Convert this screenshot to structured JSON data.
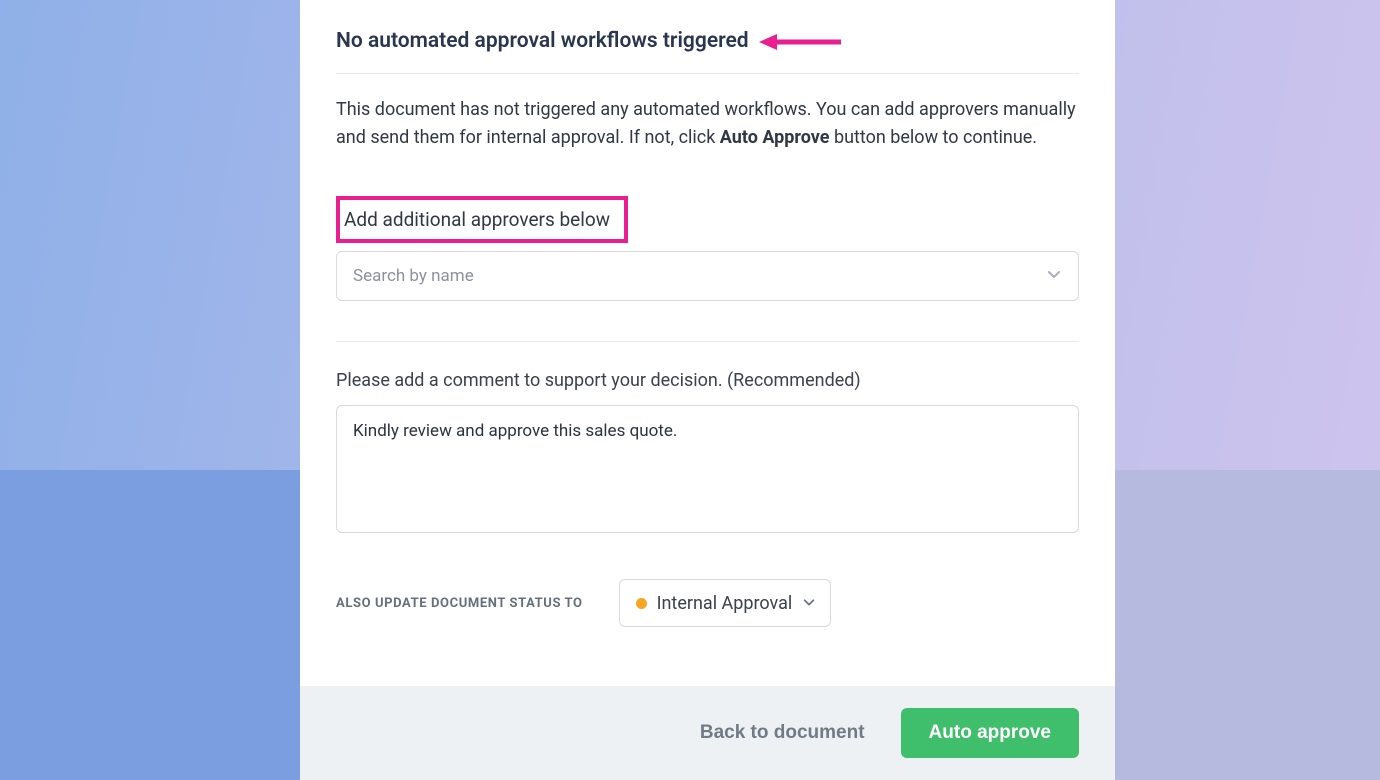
{
  "heading": "No automated approval workflows triggered",
  "description": {
    "pre": "This document has not triggered any automated workflows. You can add approvers manually and send them for internal approval. If not, click ",
    "bold": "Auto Approve",
    "post": " button below to continue."
  },
  "approvers": {
    "label": "Add additional approvers below",
    "placeholder": "Search by name"
  },
  "comment": {
    "label": "Please add a comment to support your decision. (Recommended)",
    "value": "Kindly review and approve this sales quote."
  },
  "status": {
    "label": "ALSO UPDATE DOCUMENT STATUS TO",
    "selected": "Internal Approval",
    "dot_color": "#f5a623"
  },
  "footer": {
    "back": "Back to document",
    "primary": "Auto approve"
  },
  "annotation": {
    "arrow_color": "#e91e90",
    "highlight_color": "#e91e90"
  }
}
